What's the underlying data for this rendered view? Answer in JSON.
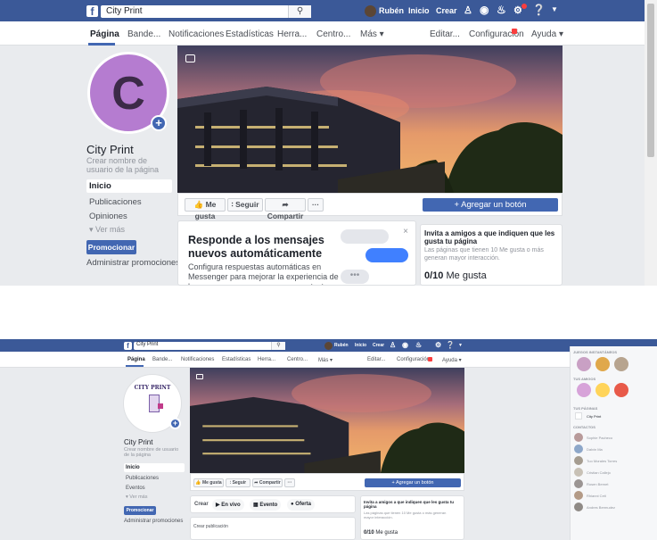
{
  "shot_a": {
    "topbar": {
      "logo": "f",
      "search_value": "City Print",
      "search_icon": "magnifier",
      "user": "Rubén",
      "home": "Inicio",
      "create": "Crear"
    },
    "page_nav": {
      "items": [
        "Página",
        "Bande...",
        "Notificaciones",
        "Estadísticas",
        "Herra...",
        "Centro...",
        "Más ▾",
        "Editar...",
        "Configuración",
        "Ayuda ▾"
      ]
    },
    "profile": {
      "letter": "C",
      "name": "City Print",
      "username_hint": "Crear nombre de usuario de la página",
      "add_icon": "+"
    },
    "sidebar": {
      "items": [
        "Inicio",
        "Publicaciones",
        "Opiniones"
      ],
      "more": "Ver más",
      "promote_button": "Promocionar",
      "manage_promotions": "Administrar promociones"
    },
    "actions": {
      "like": "Me gusta",
      "follow": "Seguir",
      "share": "Compartir",
      "more": "···",
      "add_button": "+ Agregar un botón"
    },
    "messenger_card": {
      "title": "Responde a los mensajes nuevos automáticamente",
      "body": "Configura respuestas automáticas en Messenger para mejorar la experiencia de las personas que se ponen en contacto con tu página. Puedes",
      "close": "×"
    },
    "invite_card": {
      "title": "Invita a amigos a que indiquen que les gusta tu página",
      "body": "Las páginas que tienen 10 Me gusta o más generan mayor interacción.",
      "count": "0/10",
      "count_label": "Me gusta"
    }
  },
  "shot_b": {
    "topbar": {
      "logo": "f",
      "search_value": "City Print",
      "user": "Rubén",
      "home": "Inicio",
      "create": "Crear"
    },
    "page_nav": {
      "items": [
        "Página",
        "Bande...",
        "Notificaciones",
        "Estadísticas",
        "Herra...",
        "Centro...",
        "Más ▾",
        "Editar...",
        "Configuración",
        "Ayuda ▾"
      ]
    },
    "profile": {
      "logo_text": "CITY PRINT",
      "name": "City Print",
      "username_hint": "Crear nombre de usuario de la página"
    },
    "sidebar": {
      "items": [
        "Inicio",
        "Publicaciones",
        "Eventos"
      ],
      "more": "Ver más",
      "promote_button": "Promocionar",
      "manage_promotions": "Administrar promociones"
    },
    "actions": {
      "like": "Me gusta",
      "follow": "Seguir",
      "share": "Compartir",
      "more": "···",
      "add_button": "+ Agregar un botón"
    },
    "composer": {
      "create": "Crear",
      "live": "En vivo",
      "event": "Evento",
      "offer": "Oferta",
      "create_post": "Crear publicación"
    },
    "invite_card": {
      "title": "Invita a amigos a que indiquen que les gusta tu página",
      "body": "Las páginas que tienen 10 Me gusta o más generan mayor interacción.",
      "count": "0/10",
      "count_label": "Me gusta"
    },
    "right_rail": {
      "games_header": "JUEGOS INSTANTÁNEOS",
      "friends_header": "TUS AMIGOS",
      "pages_header": "TUS PÁGINAS",
      "page_name": "City Print",
      "contacts_header": "CONTACTOS",
      "contacts": [
        "Sophie Pacheco",
        "Dalvin Ma",
        "Tuo Morales Torres",
        "Cristian Callejo",
        "Rosen Bernet",
        "Rhianni Ceti",
        "Andres Bermudez"
      ]
    }
  }
}
